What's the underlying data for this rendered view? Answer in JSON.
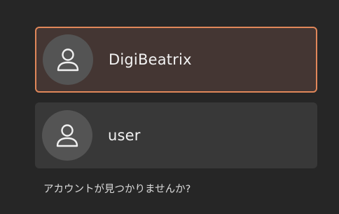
{
  "users": [
    {
      "name": "DigiBeatrix",
      "avatar_icon": "person-icon",
      "selected": true
    },
    {
      "name": "user",
      "avatar_icon": "person-icon",
      "selected": false
    }
  ],
  "not_listed_label": "アカウントが見つかりませんか?",
  "colors": {
    "background": "#262626",
    "card": "#383838",
    "card_selected": "#443633",
    "accent": "#e0875a",
    "avatar_bg": "#545454",
    "text": "#f2f2f2"
  }
}
